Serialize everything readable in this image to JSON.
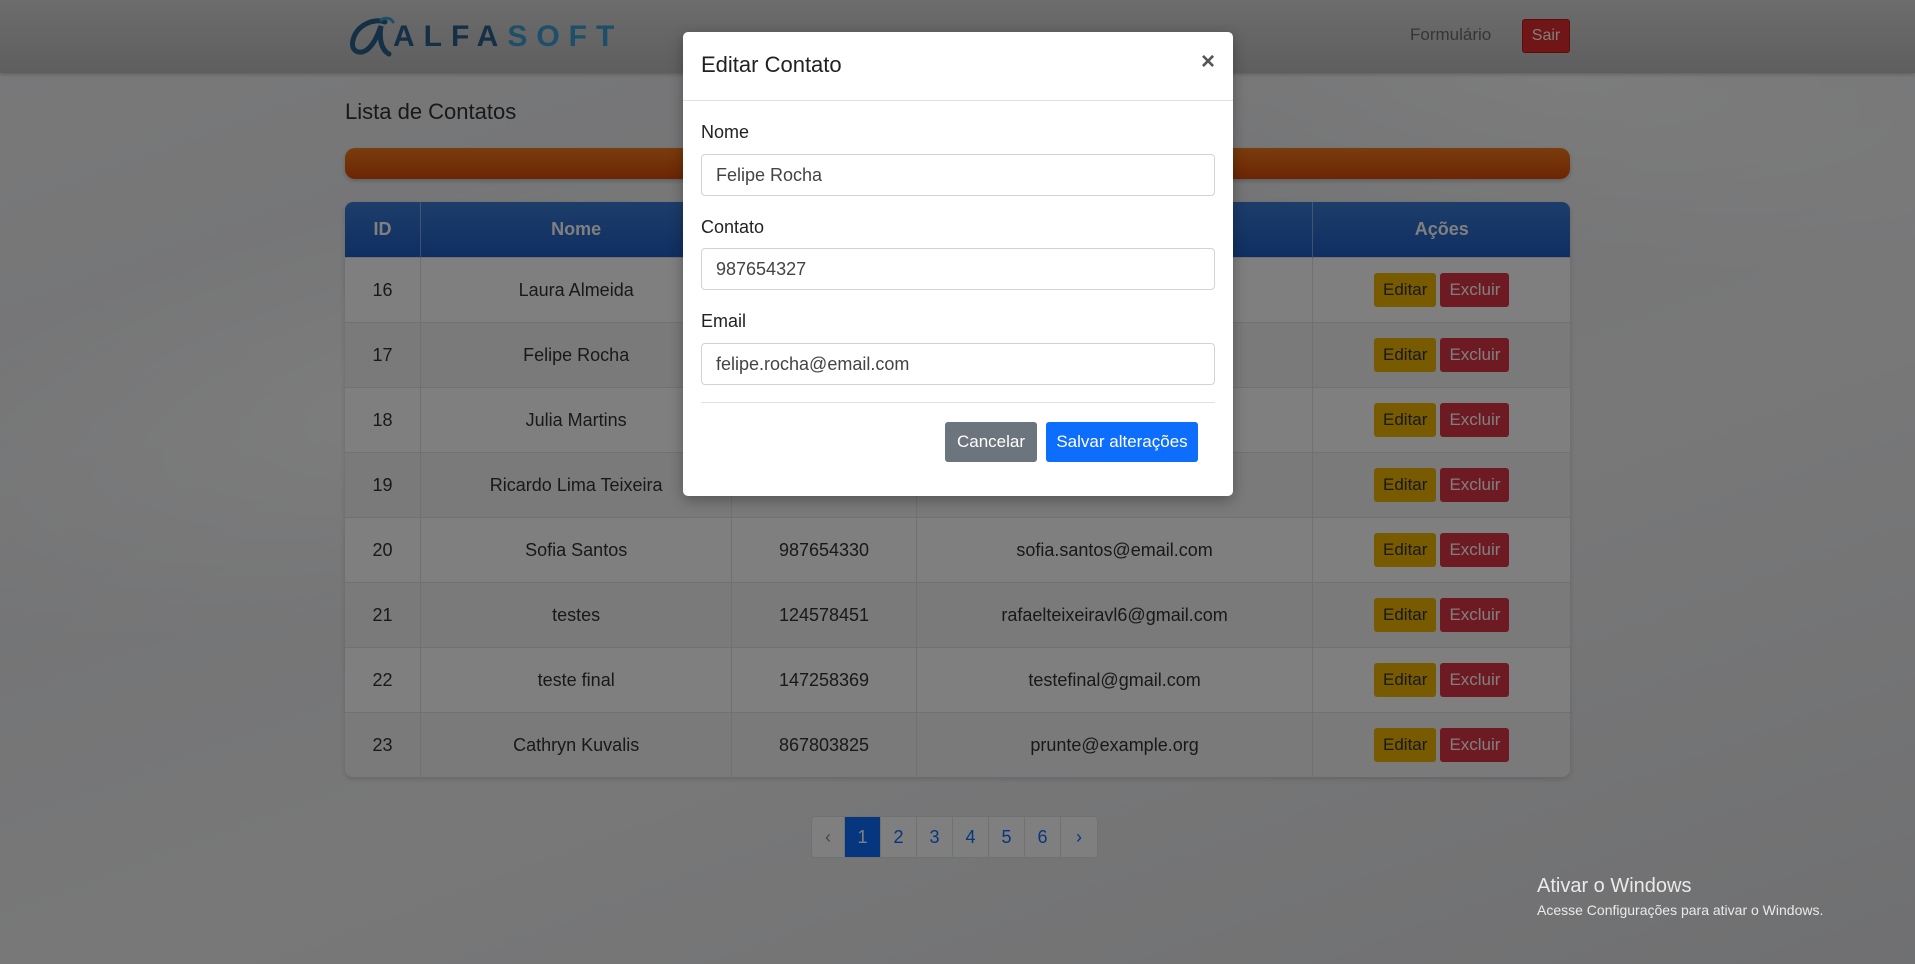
{
  "navbar": {
    "logo_text_a": "ALFA",
    "logo_text_b": "SOFT",
    "form_link": "Formulário",
    "logout_label": "Sair"
  },
  "page": {
    "title": "Lista de Contatos"
  },
  "table": {
    "headers": [
      "ID",
      "Nome",
      "",
      "",
      "Ações"
    ],
    "edit_label": "Editar",
    "delete_label": "Excluir",
    "rows": [
      {
        "id": "16",
        "name": "Laura Almeida",
        "contact": "",
        "email": ""
      },
      {
        "id": "17",
        "name": "Felipe Rocha",
        "contact": "",
        "email": ""
      },
      {
        "id": "18",
        "name": "Julia Martins",
        "contact": "",
        "email": ""
      },
      {
        "id": "19",
        "name": "Ricardo Lima Teixeira",
        "contact": "",
        "email": ""
      },
      {
        "id": "20",
        "name": "Sofia Santos",
        "contact": "987654330",
        "email": "sofia.santos@email.com"
      },
      {
        "id": "21",
        "name": "testes",
        "contact": "124578451",
        "email": "rafaelteixeiravl6@gmail.com"
      },
      {
        "id": "22",
        "name": "teste final",
        "contact": "147258369",
        "email": "testefinal@gmail.com"
      },
      {
        "id": "23",
        "name": "Cathryn Kuvalis",
        "contact": "867803825",
        "email": "prunte@example.org"
      }
    ]
  },
  "pagination": {
    "prev": "‹",
    "pages": [
      "1",
      "2",
      "3",
      "4",
      "5",
      "6"
    ],
    "active_page": "1",
    "next": "›"
  },
  "modal": {
    "title": "Editar Contato",
    "close": "×",
    "name_label": "Nome",
    "name_value": "Felipe Rocha",
    "contact_label": "Contato",
    "contact_value": "987654327",
    "email_label": "Email",
    "email_value": "felipe.rocha@email.com",
    "cancel_label": "Cancelar",
    "save_label": "Salvar alterações"
  },
  "watermark": {
    "title": "Ativar o Windows",
    "subtitle": "Acesse Configurações para ativar o Windows."
  },
  "colors": {
    "accent": "#0d6efd",
    "danger": "#dc3545",
    "warning": "#f0b400",
    "table_header": "#1f5ec5",
    "progress_bar": "#e15a0e"
  }
}
